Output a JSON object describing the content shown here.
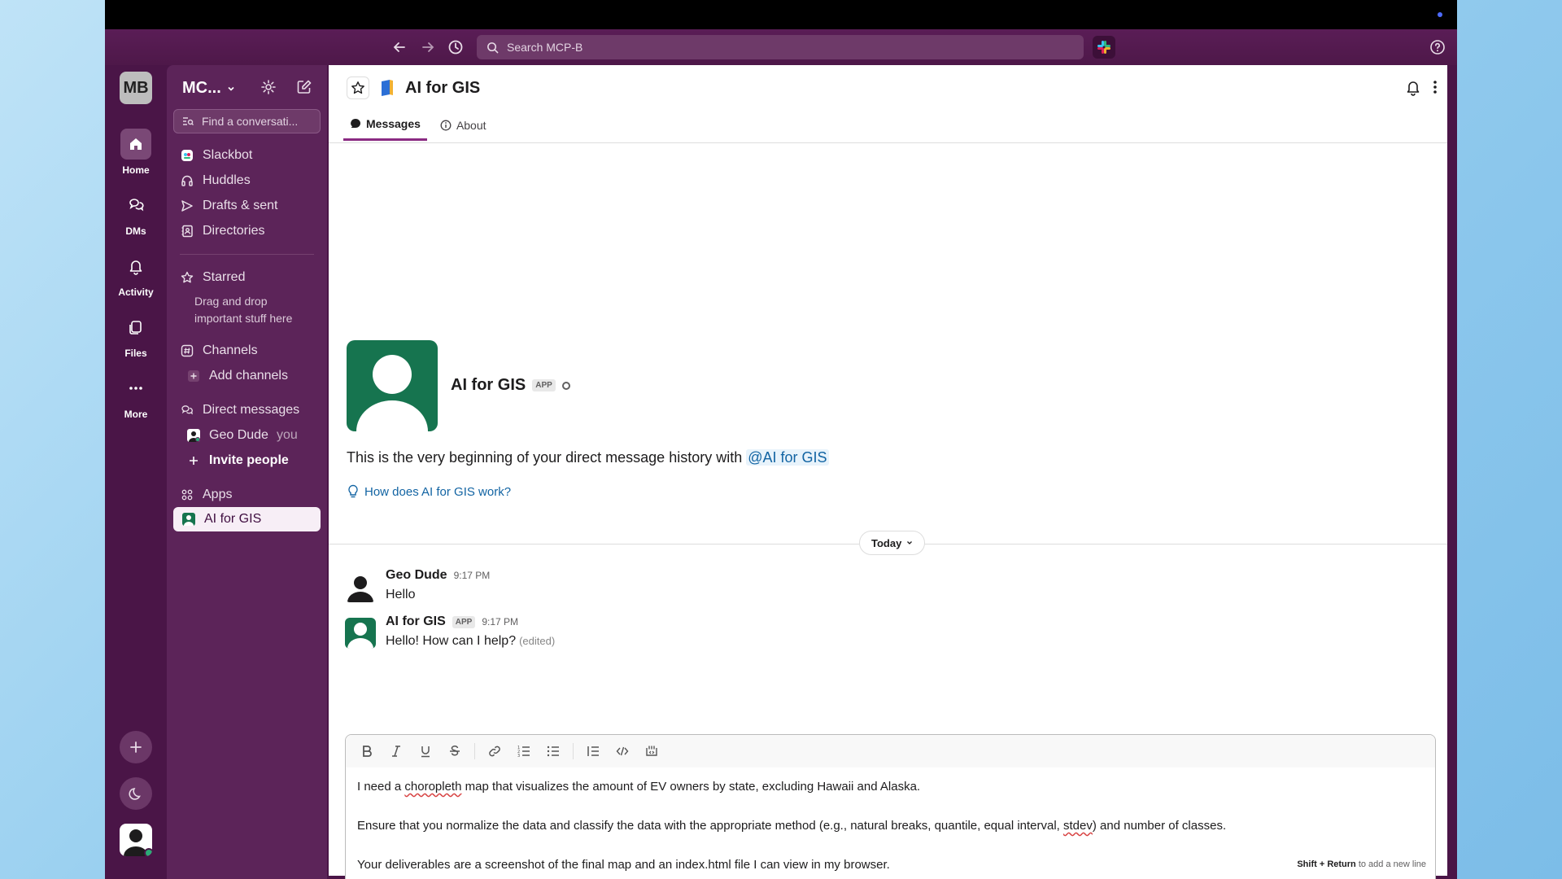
{
  "app": {
    "search_placeholder": "Search MCP-B",
    "workspace_initials": "MB"
  },
  "rail": {
    "items": [
      {
        "label": "Home"
      },
      {
        "label": "DMs"
      },
      {
        "label": "Activity"
      },
      {
        "label": "Files"
      },
      {
        "label": "More"
      }
    ]
  },
  "sidebar": {
    "workspace_name": "MC...",
    "find_placeholder": "Find a conversati...",
    "items": {
      "slackbot": "Slackbot",
      "huddles": "Huddles",
      "drafts": "Drafts & sent",
      "directories": "Directories",
      "starred": "Starred",
      "starred_hint_1": "Drag and drop",
      "starred_hint_2": "important stuff here",
      "channels": "Channels",
      "add_channels": "Add channels",
      "direct_messages": "Direct messages",
      "geo_dude": "Geo Dude",
      "you": "you",
      "invite": "Invite people",
      "apps": "Apps",
      "ai_for_gis": "AI for GIS"
    }
  },
  "channel": {
    "title": "AI for GIS",
    "tabs": [
      "Messages",
      "About"
    ],
    "intro_name": "AI for GIS",
    "app_badge": "APP",
    "intro_text_prefix": "This is the very beginning of your direct message history with ",
    "intro_mention": "@AI for GIS",
    "how_link": "How does AI for GIS work?",
    "day_label": "Today"
  },
  "messages": [
    {
      "author": "Geo Dude",
      "time": "9:17 PM",
      "text": "Hello",
      "badge": "",
      "edited": ""
    },
    {
      "author": "AI for GIS",
      "time": "9:17 PM",
      "text": "Hello! How can I help?",
      "badge": "APP",
      "edited": "(edited)"
    }
  ],
  "composer": {
    "line1_a": "I need a ",
    "line1_b": "choropleth",
    "line1_c": " map that visualizes the amount of EV owners by state, excluding Hawaii and Alaska.",
    "line2_a": "Ensure that you normalize the data and classify the data with the appropriate method (e.g., natural breaks, quantile, equal interval, ",
    "line2_b": "stdev",
    "line2_c": ") and number of classes.",
    "line3": "Your deliverables are a screenshot of the final map and an index.html file I can view in my browser.",
    "hint_key": "Shift + Return",
    "hint_text": " to add a new line"
  },
  "colors": {
    "aubergine": "#4a1547",
    "sidebar": "#5c2459",
    "accent": "#8a2a82",
    "send": "#007a5a",
    "link": "#1264a3",
    "bot_avatar": "#16744f"
  }
}
